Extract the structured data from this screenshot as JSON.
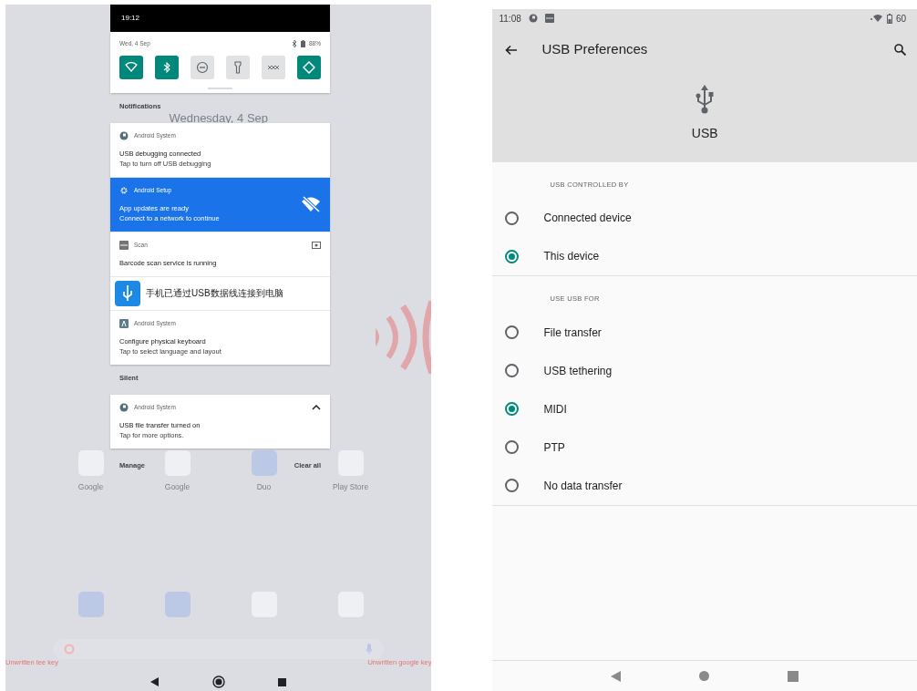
{
  "left_screen": {
    "status_bar": {
      "time": "19:12"
    },
    "quick_settings": {
      "date": "Wed, 4 Sep",
      "battery": "88%",
      "tiles": [
        {
          "kind": "wifi",
          "on": true
        },
        {
          "kind": "bluetooth",
          "on": true
        },
        {
          "kind": "dnd",
          "on": false
        },
        {
          "kind": "flashlight",
          "on": false
        },
        {
          "kind": "data_saver",
          "on": false
        },
        {
          "kind": "rotate",
          "on": true
        }
      ]
    },
    "notifications_header": "Notifications",
    "notifications": [
      {
        "kind": "standard",
        "app": "Android System",
        "title": "USB debugging connected",
        "text": "Tap to turn off USB debugging",
        "highlighted": false
      },
      {
        "kind": "standard",
        "app": "Android Setup",
        "title": "App updates are ready",
        "text": "Connect to a network to continue",
        "highlighted": true
      },
      {
        "kind": "standard",
        "app": "Scan",
        "title": "Barcode scan service is running",
        "highlighted": false
      },
      {
        "kind": "compact",
        "title": "手机已通过USB数据线连接到电脑",
        "highlighted": false
      },
      {
        "kind": "standard",
        "app": "Android System",
        "title": "Configure physical keyboard",
        "text": "Tap to select language and layout",
        "highlighted": false
      }
    ],
    "silent_header": "Silent",
    "silent_notifications": [
      {
        "app": "Android System",
        "title": "USB file transfer turned on",
        "text": "Tap for more options.",
        "expanded": true
      }
    ],
    "actions": [
      "Manage",
      "Clear all"
    ],
    "home": {
      "date": "Wednesday, 4 Sep",
      "apps": [
        {
          "label": "Google"
        },
        {
          "label": "Google"
        },
        {
          "label": "Duo"
        },
        {
          "label": "Play Store"
        }
      ],
      "key_labels": [
        "Unwritten tee key",
        "Unwritten google key"
      ]
    }
  },
  "right_screen": {
    "status_bar": {
      "time": "11:08",
      "battery": "60"
    },
    "title": "USB Preferences",
    "header": "USB",
    "sections": [
      {
        "heading": "USB CONTROLLED BY",
        "options": [
          {
            "label": "Connected device",
            "selected": false
          },
          {
            "label": "This device",
            "selected": true
          }
        ]
      },
      {
        "heading": "USE USB FOR",
        "options": [
          {
            "label": "File transfer",
            "selected": false
          },
          {
            "label": "USB tethering",
            "selected": false
          },
          {
            "label": "MIDI",
            "selected": true
          },
          {
            "label": "PTP",
            "selected": false
          },
          {
            "label": "No data transfer",
            "selected": false
          }
        ]
      }
    ]
  }
}
